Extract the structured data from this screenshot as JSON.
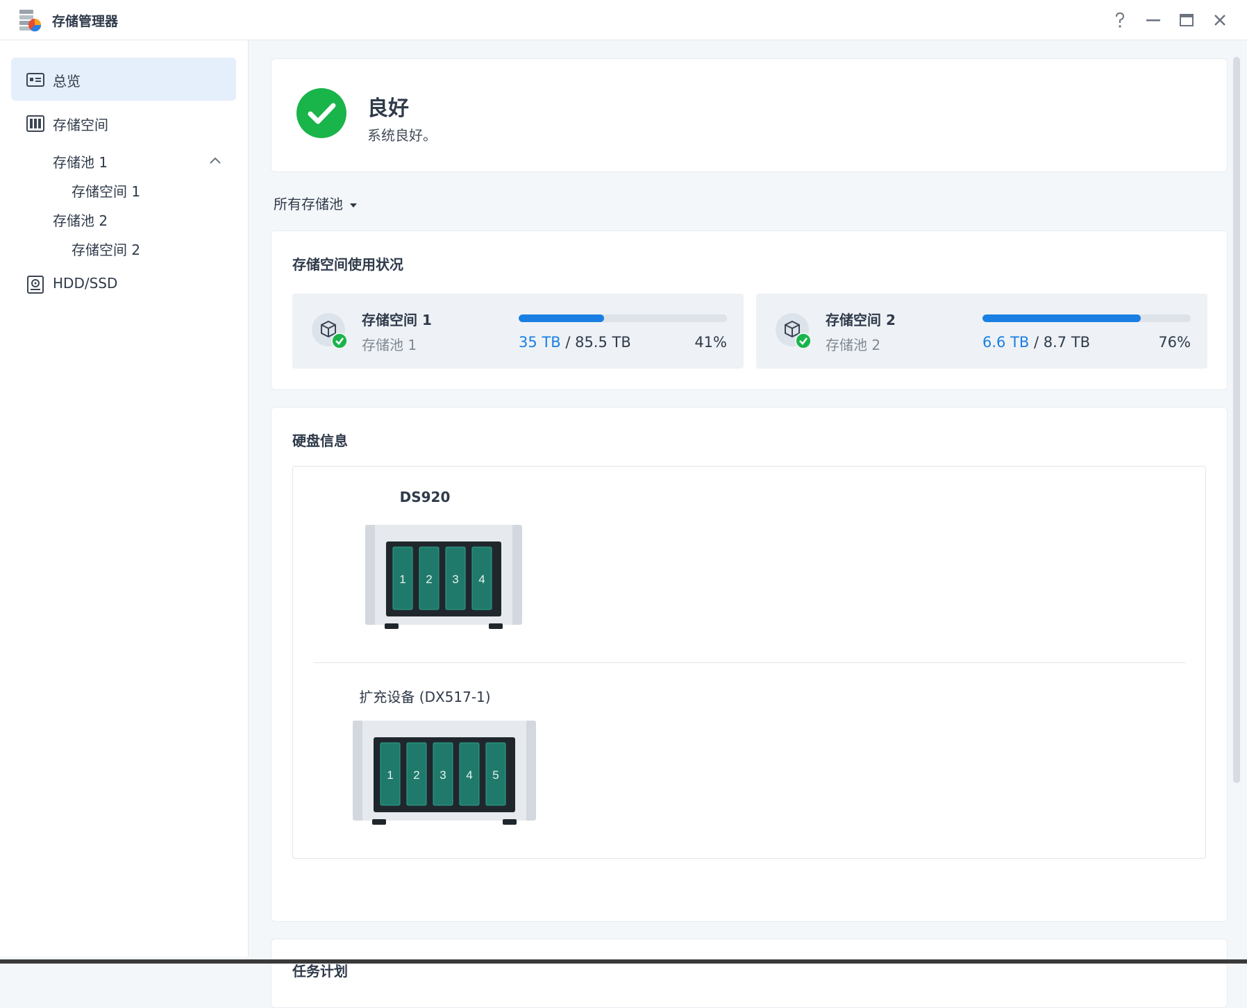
{
  "window": {
    "title": "存储管理器"
  },
  "sidebar": {
    "items": [
      {
        "label": "总览",
        "icon": "overview-icon",
        "active": true
      },
      {
        "label": "存储空间",
        "icon": "storage-icon",
        "expanded": true
      },
      {
        "label": "存储池 1"
      },
      {
        "label": "存储空间 1"
      },
      {
        "label": "存储池 2"
      },
      {
        "label": "存储空间 2"
      },
      {
        "label": "HDD/SSD",
        "icon": "hdd-icon"
      }
    ]
  },
  "status": {
    "title": "良好",
    "description": "系统良好。",
    "color": "#19b44a"
  },
  "filter": {
    "label": "所有存储池"
  },
  "usage": {
    "title": "存储空间使用状况",
    "volumes": [
      {
        "name": "存储空间 1",
        "pool": "存储池 1",
        "used": "35 TB",
        "total": "85.5 TB",
        "percent": "41%",
        "fill": 0.41
      },
      {
        "name": "存储空间 2",
        "pool": "存储池 2",
        "used": "6.6 TB",
        "total": "8.7 TB",
        "percent": "76%",
        "fill": 0.76
      }
    ]
  },
  "disks": {
    "title": "硬盘信息",
    "devices": [
      {
        "name": "DS920",
        "bays": [
          "1",
          "2",
          "3",
          "4"
        ]
      },
      {
        "name": "扩充设备 (DX517-1)",
        "bays": [
          "1",
          "2",
          "3",
          "4",
          "5"
        ]
      }
    ]
  },
  "tasks": {
    "title": "任务计划"
  },
  "colors": {
    "accent": "#1a7fe3",
    "ok": "#19b44a",
    "bay": "#1f7a6b"
  }
}
